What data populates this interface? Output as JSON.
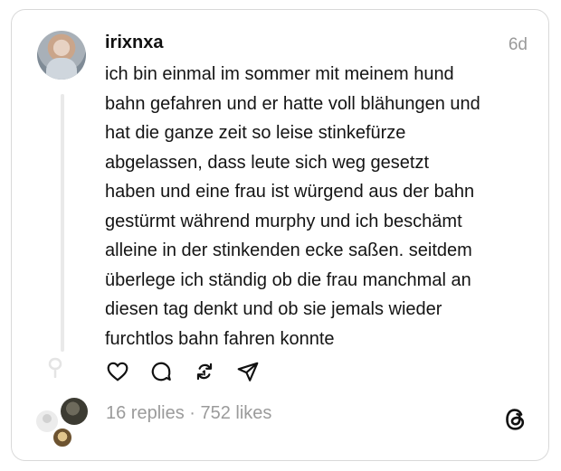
{
  "post": {
    "username": "irixnxa",
    "time": "6d",
    "text": "ich bin einmal im sommer mit meinem hund\nbahn gefahren und er hatte voll blähungen und\nhat die ganze zeit so leise stinkefürze\nabgelassen, dass leute sich weg gesetzt\nhaben und eine frau ist würgend aus der bahn\ngestürmt während murphy und ich beschämt\nalleine in der stinkenden ecke saßen. seitdem\nüberlege ich ständig ob die frau manchmal an\ndiesen tag denkt und ob sie jemals wieder\nfurchtlos bahn fahren konnte"
  },
  "actions": {
    "icons": [
      "heart-icon",
      "comment-icon",
      "repost-icon",
      "share-icon"
    ]
  },
  "stats": {
    "summary": "16 replies · 752 likes"
  },
  "colors": {
    "text": "#141414",
    "muted": "#9b9b9b",
    "border": "#d9d9d9"
  }
}
